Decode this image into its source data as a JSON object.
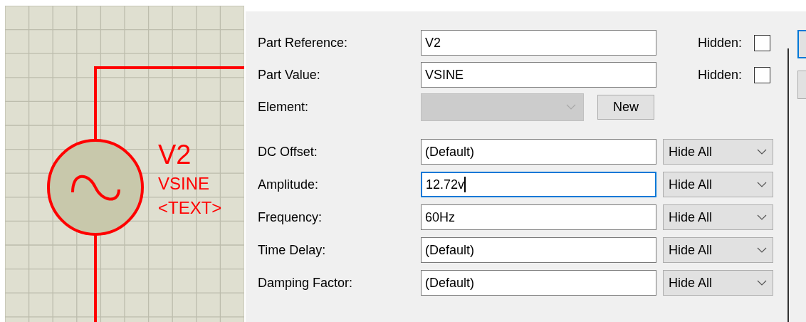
{
  "schematic": {
    "reference": "V2",
    "value": "VSINE",
    "text": "<TEXT>"
  },
  "part_fields": [
    {
      "label": "Part Reference:",
      "value": "V2",
      "hidden_label": "Hidden:",
      "hidden": false
    },
    {
      "label": "Part Value:",
      "value": "VSINE",
      "hidden_label": "Hidden:",
      "hidden": false
    }
  ],
  "element": {
    "label": "Element:",
    "disabled": true,
    "button": "New"
  },
  "properties": [
    {
      "label": "DC Offset:",
      "value": "(Default)",
      "focused": false,
      "visibility": "Hide All"
    },
    {
      "label": "Amplitude:",
      "value": "12.72v",
      "focused": true,
      "visibility": "Hide All"
    },
    {
      "label": "Frequency:",
      "value": "60Hz",
      "focused": false,
      "visibility": "Hide All"
    },
    {
      "label": "Time Delay:",
      "value": "(Default)",
      "focused": false,
      "visibility": "Hide All"
    },
    {
      "label": "Damping Factor:",
      "value": "(Default)",
      "focused": false,
      "visibility": "Hide All"
    }
  ],
  "side_buttons": [
    {
      "default": true
    },
    {
      "default": false
    }
  ]
}
